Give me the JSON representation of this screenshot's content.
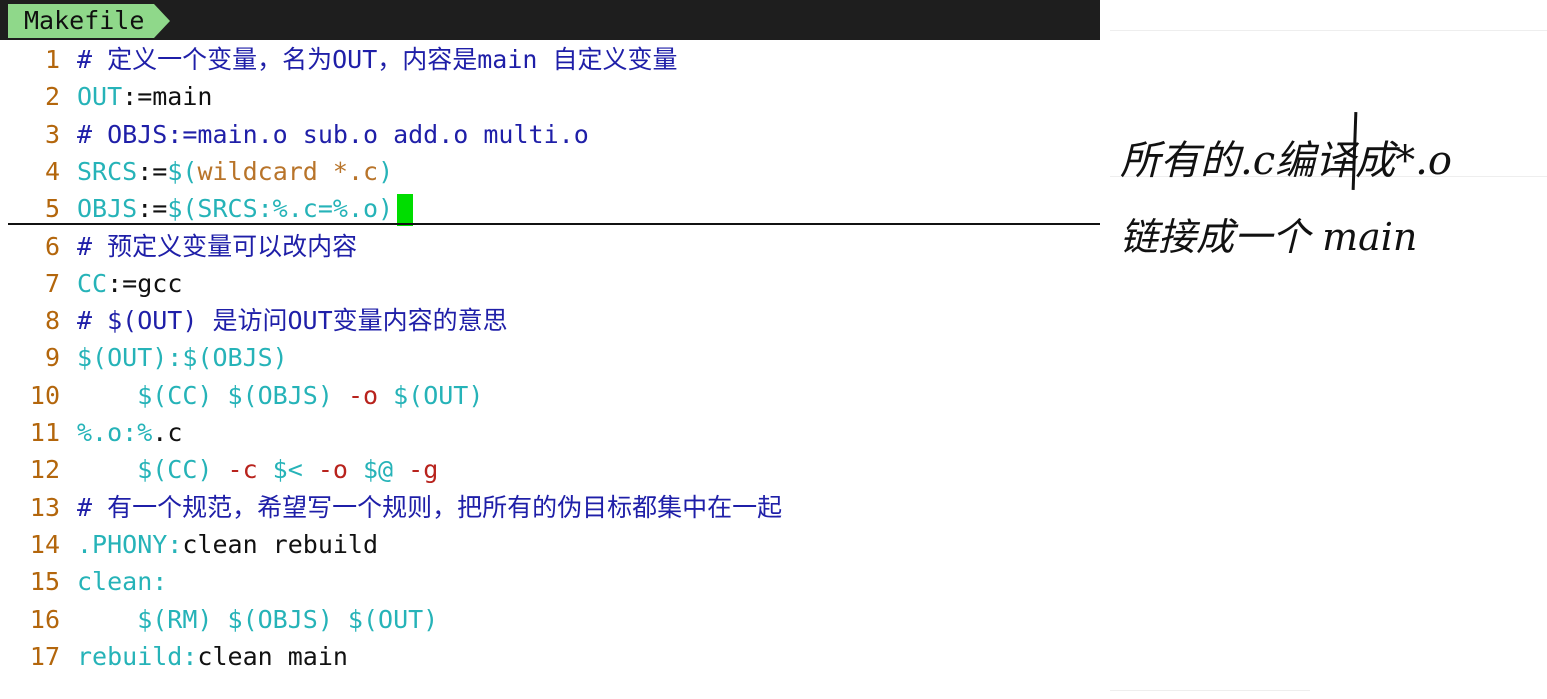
{
  "tab": {
    "filename": "Makefile"
  },
  "editor": {
    "lines": [
      {
        "num": "1",
        "segments": [
          {
            "text": "# 定义一个变量，名为OUT，内容是main 自定义变量",
            "kind": "comment"
          }
        ]
      },
      {
        "num": "2",
        "segments": [
          {
            "text": "OUT",
            "kind": "var"
          },
          {
            "text": ":=main",
            "kind": "plain"
          }
        ]
      },
      {
        "num": "3",
        "segments": [
          {
            "text": "# OBJS:=main.o sub.o add.o multi.o",
            "kind": "comment"
          }
        ]
      },
      {
        "num": "4",
        "segments": [
          {
            "text": "SRCS",
            "kind": "var"
          },
          {
            "text": ":=",
            "kind": "plain"
          },
          {
            "text": "$(",
            "kind": "var"
          },
          {
            "text": "wildcard *.c",
            "kind": "func"
          },
          {
            "text": ")",
            "kind": "var"
          }
        ]
      },
      {
        "num": "5",
        "segments": [
          {
            "text": "OBJS",
            "kind": "var"
          },
          {
            "text": ":=",
            "kind": "plain"
          },
          {
            "text": "$(SRCS:%.c=%.o)",
            "kind": "var"
          }
        ]
      },
      {
        "num": "6",
        "segments": [
          {
            "text": "# 预定义变量可以改内容",
            "kind": "comment"
          }
        ]
      },
      {
        "num": "7",
        "segments": [
          {
            "text": "CC",
            "kind": "var"
          },
          {
            "text": ":=gcc",
            "kind": "plain"
          }
        ]
      },
      {
        "num": "8",
        "segments": [
          {
            "text": "# $(OUT) 是访问OUT变量内容的意思",
            "kind": "comment"
          }
        ]
      },
      {
        "num": "9",
        "segments": [
          {
            "text": "$(OUT):$(OBJS)",
            "kind": "var"
          }
        ]
      },
      {
        "num": "10",
        "segments": [
          {
            "text": "    $(CC) $(OBJS) ",
            "kind": "var"
          },
          {
            "text": "-o",
            "kind": "flag"
          },
          {
            "text": " $(OUT)",
            "kind": "var"
          }
        ]
      },
      {
        "num": "11",
        "segments": [
          {
            "text": "%.o:%",
            "kind": "var"
          },
          {
            "text": ".c",
            "kind": "plain"
          }
        ]
      },
      {
        "num": "12",
        "segments": [
          {
            "text": "    $(CC) ",
            "kind": "var"
          },
          {
            "text": "-c",
            "kind": "flag"
          },
          {
            "text": " $< ",
            "kind": "var"
          },
          {
            "text": "-o",
            "kind": "flag"
          },
          {
            "text": " $@ ",
            "kind": "var"
          },
          {
            "text": "-g",
            "kind": "flag"
          }
        ]
      },
      {
        "num": "13",
        "segments": [
          {
            "text": "# 有一个规范，希望写一个规则，把所有的伪目标都集中在一起",
            "kind": "comment"
          }
        ]
      },
      {
        "num": "14",
        "segments": [
          {
            "text": ".PHONY:",
            "kind": "var"
          },
          {
            "text": "clean rebuild",
            "kind": "plain"
          }
        ]
      },
      {
        "num": "15",
        "segments": [
          {
            "text": "clean:",
            "kind": "var"
          }
        ]
      },
      {
        "num": "16",
        "segments": [
          {
            "text": "    $(RM) $(OBJS) $(OUT)",
            "kind": "var"
          }
        ]
      },
      {
        "num": "17",
        "segments": [
          {
            "text": "rebuild:",
            "kind": "var"
          },
          {
            "text": "clean main",
            "kind": "plain"
          }
        ]
      }
    ],
    "cursor_line": "5",
    "cursor_color": "#00dd00"
  },
  "notes": {
    "line1": "所有的.c编译成*.o",
    "line2": "链接成一个 main"
  },
  "colors": {
    "comment": "#1f1fa8",
    "variable": "#26b3b8",
    "function": "#b8742a",
    "flag": "#b8231d",
    "line_number": "#b3660c",
    "tab_bg": "#8fd88a",
    "topbar_bg": "#1e1e1e"
  }
}
